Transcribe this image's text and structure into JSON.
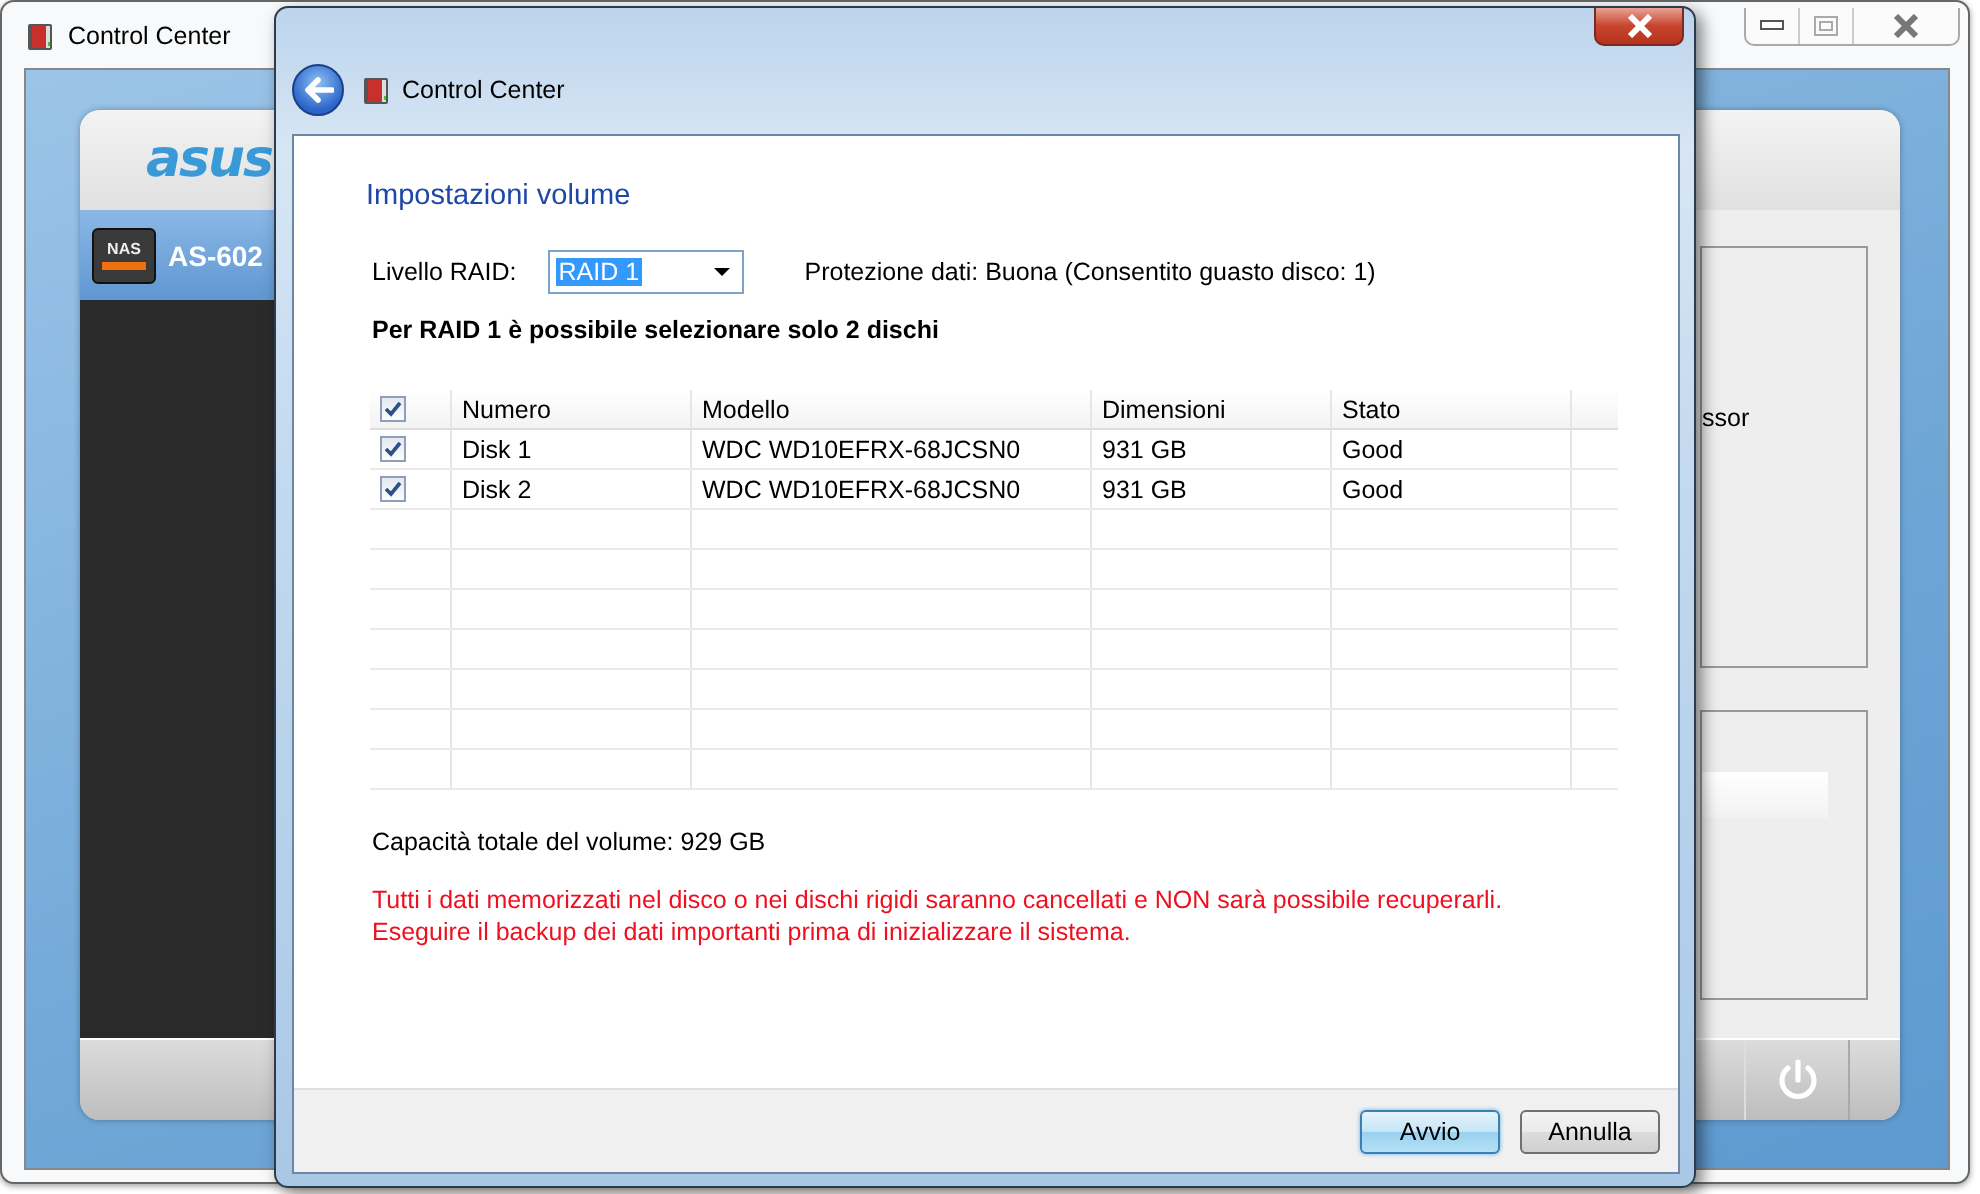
{
  "background_window": {
    "title": "Control Center",
    "logo": "asus",
    "device": {
      "icon_text": "NAS",
      "label": "AS-602",
      "selected": true
    },
    "panel_text": "ssor"
  },
  "dialog": {
    "title": "Control Center",
    "heading": "Impostazioni volume",
    "raid_label": "Livello RAID:",
    "raid_value": "RAID 1",
    "protection": "Protezione dati: Buona (Consentito guasto disco: 1)",
    "notice": "Per RAID 1 è possibile selezionare solo 2 dischi",
    "table": {
      "select_all_checked": true,
      "columns": [
        "Numero",
        "Modello",
        "Dimensioni",
        "Stato"
      ],
      "rows": [
        {
          "checked": true,
          "cells": [
            "Disk 1",
            "WDC WD10EFRX-68JCSN0",
            "931 GB",
            "Good"
          ]
        },
        {
          "checked": true,
          "cells": [
            "Disk 2",
            "WDC WD10EFRX-68JCSN0",
            "931 GB",
            "Good"
          ]
        }
      ]
    },
    "capacity": "Capacità totale del volume: 929 GB",
    "warnings": [
      "Tutti i dati memorizzati nel disco o nei dischi rigidi saranno cancellati e NON sarà possibile recuperarli.",
      "Eseguire il backup dei dati importanti prima di inizializzare il sistema."
    ],
    "buttons": [
      {
        "label": "Avvio",
        "default": true
      },
      {
        "label": "Annulla",
        "default": false
      }
    ]
  }
}
